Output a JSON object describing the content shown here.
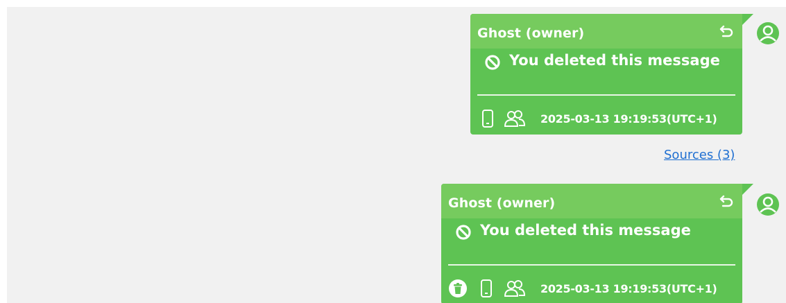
{
  "colors": {
    "bubble": "#5ec353",
    "bubble_header": "#76cb5e",
    "background": "#f1f1f1",
    "link": "#1f6fd1"
  },
  "messages": [
    {
      "sender": "Ghost (owner)",
      "text": "You deleted this message",
      "timestamp": "2025-03-13 19:19:53(UTC+1)",
      "icons": [
        "reply-icon",
        "deleted-icon",
        "phone-icon",
        "group-icon",
        "avatar-icon"
      ]
    },
    {
      "sender": "Ghost (owner)",
      "text": "You deleted this message",
      "timestamp": "2025-03-13 19:19:53(UTC+1)",
      "icons": [
        "reply-icon",
        "deleted-icon",
        "trash-icon",
        "phone-icon",
        "group-icon",
        "avatar-icon"
      ]
    }
  ],
  "sources_link": "Sources (3)"
}
